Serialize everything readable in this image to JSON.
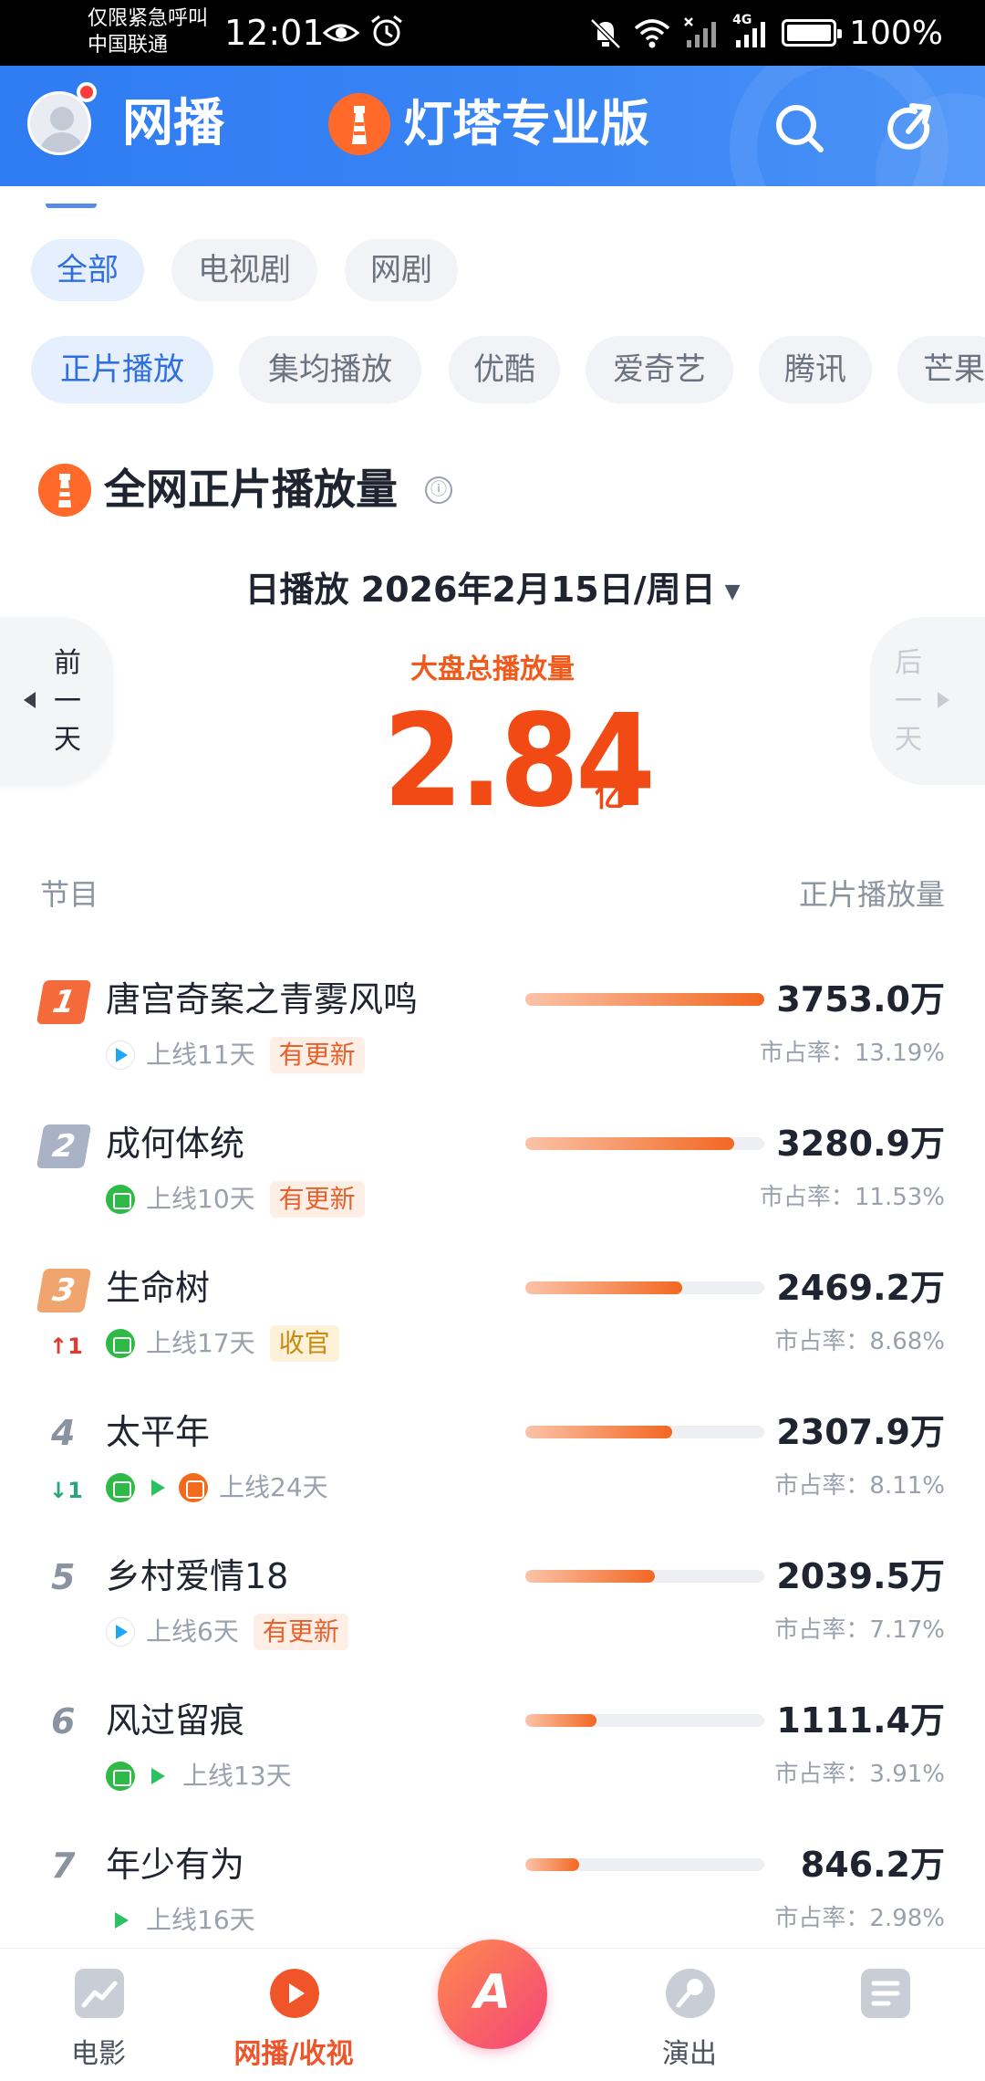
{
  "status_bar": {
    "carrier_line1": "仅限紧急呼叫",
    "carrier_line2": "中国联通",
    "time": "12:01",
    "network": "4G",
    "battery": "100%"
  },
  "header": {
    "title": "网播",
    "brand": "灯塔专业版"
  },
  "category_tabs": [
    "全部",
    "电视剧",
    "网剧"
  ],
  "metric_tabs": [
    "正片播放",
    "集均播放",
    "优酷",
    "爱奇艺",
    "腾讯",
    "芒果"
  ],
  "section": {
    "title": "全网正片播放量",
    "info_icon": "ⓘ"
  },
  "date_selector": {
    "text": "日播放 2026年2月15日/周日",
    "prev_label": "前一天",
    "next_label": "后一天"
  },
  "total": {
    "label": "大盘总播放量",
    "value": "2.84",
    "unit": "亿"
  },
  "columns": {
    "program": "节目",
    "views": "正片播放量"
  },
  "rows": [
    {
      "rank": "1",
      "title": "唐宫奇案之青雾风鸣",
      "platforms": [
        "youku"
      ],
      "online": "上线11天",
      "tag": "有更新",
      "tag_type": "update",
      "value": "3753.0万",
      "share": "市占率：13.19%",
      "bar": 1.0,
      "move": ""
    },
    {
      "rank": "2",
      "title": "成何体统",
      "platforms": [
        "iqiyi"
      ],
      "online": "上线10天",
      "tag": "有更新",
      "tag_type": "update",
      "value": "3280.9万",
      "share": "市占率：11.53%",
      "bar": 0.874,
      "move": ""
    },
    {
      "rank": "3",
      "title": "生命树",
      "platforms": [
        "iqiyi"
      ],
      "online": "上线17天",
      "tag": "收官",
      "tag_type": "finish",
      "value": "2469.2万",
      "share": "市占率：8.68%",
      "bar": 0.658,
      "move": "↑1"
    },
    {
      "rank": "4",
      "title": "太平年",
      "platforms": [
        "iqiyi",
        "tencent",
        "mango"
      ],
      "online": "上线24天",
      "tag": "",
      "tag_type": "",
      "value": "2307.9万",
      "share": "市占率：8.11%",
      "bar": 0.615,
      "move": "↓1"
    },
    {
      "rank": "5",
      "title": "乡村爱情18",
      "platforms": [
        "youku"
      ],
      "online": "上线6天",
      "tag": "有更新",
      "tag_type": "update",
      "value": "2039.5万",
      "share": "市占率：7.17%",
      "bar": 0.543,
      "move": ""
    },
    {
      "rank": "6",
      "title": "风过留痕",
      "platforms": [
        "iqiyi",
        "tencent"
      ],
      "online": "上线13天",
      "tag": "",
      "tag_type": "",
      "value": "1111.4万",
      "share": "市占率：3.91%",
      "bar": 0.296,
      "move": ""
    },
    {
      "rank": "7",
      "title": "年少有为",
      "platforms": [
        "tencent"
      ],
      "online": "上线16天",
      "tag": "",
      "tag_type": "",
      "value": "846.2万",
      "share": "市占率：2.98%",
      "bar": 0.225,
      "move": ""
    }
  ],
  "bottom_nav": {
    "items": [
      "电影",
      "网播/收视",
      "",
      "演出",
      ""
    ],
    "center_glyph": "A",
    "active": "网播/收视"
  },
  "colors": {
    "brand_blue": "#3a86f5",
    "accent_orange": "#f24a14",
    "rank1": "#f46a3a",
    "rank2": "#aab2c5",
    "rank3": "#f0a56e",
    "up": "#e23a2e",
    "down": "#2aa57a"
  }
}
